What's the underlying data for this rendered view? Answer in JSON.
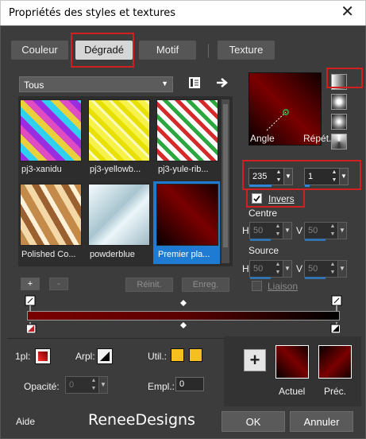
{
  "window": {
    "title": "Propriétés des styles et textures",
    "close_glyph": "✕"
  },
  "tabs": [
    {
      "label": "Couleur"
    },
    {
      "label": "Dégradé"
    },
    {
      "label": "Motif"
    },
    {
      "label": "Texture"
    }
  ],
  "library": {
    "category": "Tous",
    "items": [
      {
        "label": "pj3-xanidu"
      },
      {
        "label": "pj3-yellowb..."
      },
      {
        "label": "pj3-yule-rib..."
      },
      {
        "label": "Polished Co..."
      },
      {
        "label": "powderblue"
      },
      {
        "label": "Premier pla..."
      }
    ],
    "add_label": "+",
    "remove_label": "-",
    "reset_label": "Réinit.",
    "save_label": "Enreg."
  },
  "settings": {
    "angle_label": "Angle",
    "angle_value": "235",
    "repeat_label": "Répét.",
    "repeat_value": "1",
    "invert_label": "Invers",
    "invert_checked": true,
    "center_label": "Centre",
    "center_h_label": "H",
    "center_h_value": "50",
    "center_v_label": "V",
    "center_v_value": "50",
    "source_label": "Source",
    "source_h_label": "H",
    "source_h_value": "50",
    "source_v_label": "V",
    "source_v_value": "50",
    "link_label": "Liaison"
  },
  "bottom": {
    "first_plane_label": "1pl:",
    "back_plane_label": "Arpl:",
    "use_label": "Util.:",
    "opacity_label": "Opacité:",
    "opacity_value": "0",
    "location_label": "Empl.:",
    "location_value": "0",
    "current_label": "Actuel",
    "previous_label": "Préc.",
    "plus_label": "+"
  },
  "footer": {
    "help_label": "Aide",
    "watermark": "ReneeDesigns",
    "ok_label": "OK",
    "cancel_label": "Annuler"
  },
  "colors": {
    "accent": "#2f86d6",
    "highlight": "#d21f1f",
    "gradient_dark_red": "#7a0000",
    "gradient_black": "#0a0000",
    "swatch_yellow": "#f4c020"
  },
  "icons": [
    "library-icon",
    "arrow-right-icon",
    "sunburst-style-icon",
    "rectangular-style-icon",
    "radial-style-icon",
    "linear-style-icon",
    "checkbox-check-icon"
  ]
}
